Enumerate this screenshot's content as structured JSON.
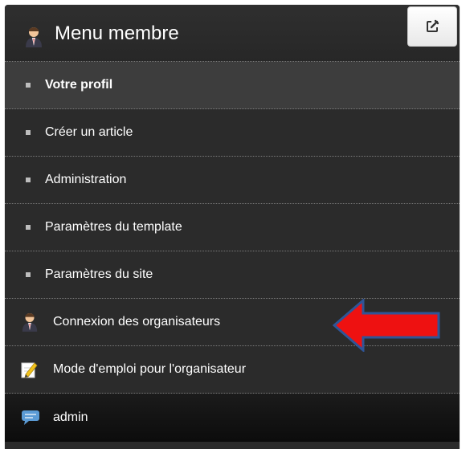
{
  "menu": {
    "title": "Menu membre",
    "items": [
      {
        "label": "Votre profil",
        "icon": "square-bullet",
        "active": true
      },
      {
        "label": "Créer un article",
        "icon": "square-bullet"
      },
      {
        "label": "Administration",
        "icon": "square-bullet"
      },
      {
        "label": "Paramètres du template",
        "icon": "square-bullet"
      },
      {
        "label": "Paramètres du site",
        "icon": "square-bullet"
      },
      {
        "label": "Connexion des organisateurs",
        "icon": "organizer-person-icon"
      },
      {
        "label": "Mode d'emploi pour l'organisateur",
        "icon": "notepad-pencil-icon"
      },
      {
        "label": "admin",
        "icon": "chat-bubble-icon"
      }
    ]
  },
  "colors": {
    "panel": "#2b2b2b",
    "active_item": "#3d3d3d",
    "arrow_fill": "#ee1111",
    "arrow_stroke": "#2f5597"
  }
}
